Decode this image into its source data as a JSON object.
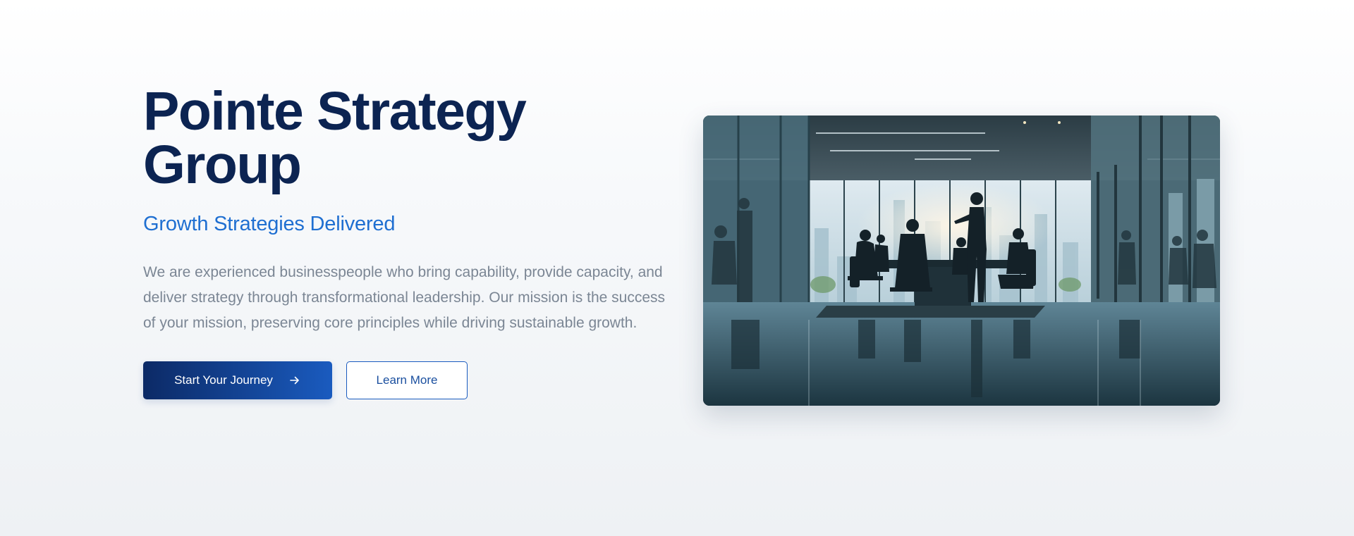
{
  "hero": {
    "title": "Pointe Strategy Group",
    "subtitle": "Growth Strategies Delivered",
    "description": "We are experienced businesspeople who bring capability, provide capacity, and deliver strategy through transformational leadership. Our mission is the success of your mission, preserving core principles while driving sustainable growth.",
    "primary_button": "Start Your Journey",
    "secondary_button": "Learn More",
    "primary_icon": "arrow-right-icon"
  },
  "colors": {
    "title": "#0c2452",
    "accent": "#1f6fd1",
    "body_text": "#7b8694",
    "button_gradient_start": "#0c2a66",
    "button_gradient_end": "#1a5bbf"
  }
}
